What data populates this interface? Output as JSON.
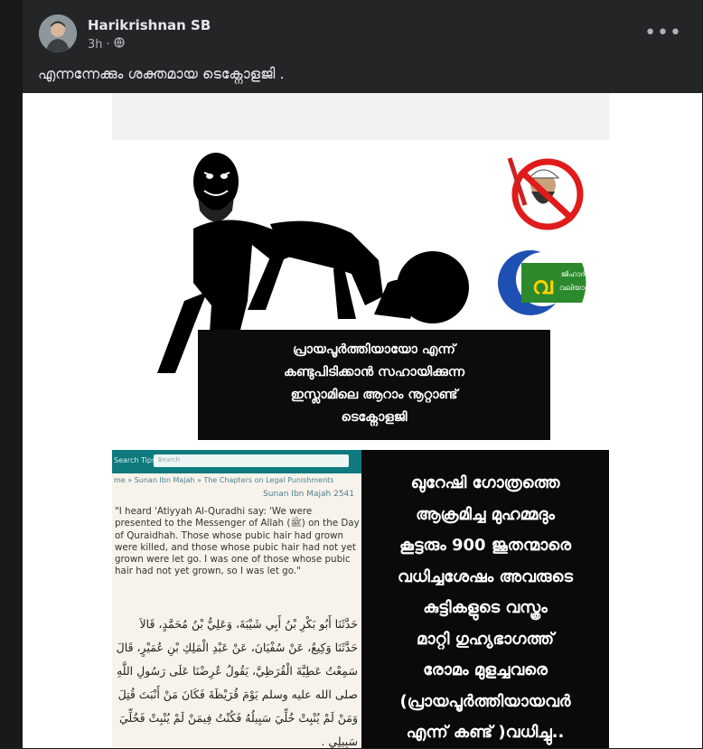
{
  "post": {
    "author": "Harikrishnan SB",
    "time": "3h",
    "separator": "·",
    "privacy_icon": "globe-icon",
    "more_icon": "more-horizontal-icon",
    "text": "എന്നന്നേക്കും ശക്തമായ ടെക്നോളജി ."
  },
  "image": {
    "stamp_lines": [
      "പ്രായപൂർത്തിയായോ എന്ന്",
      "കണ്ടുപിടിക്കാൻ സഹായിക്കുന്ന",
      "ഇസ്ലാമിലെ ആറാം നൂറ്റാണ്ട്",
      "ടെക്നോളജി"
    ],
    "logo_text": "ജിഹാദി വലിയാൾ",
    "site": {
      "search_tips": "Search Tips",
      "search_placeholder": "Search",
      "breadcrumb": "me » Sunan Ibn Majah » The Chapters on Legal Punishments",
      "reference": "Sunan Ibn Majah 2541",
      "quote": "\"I heard 'Atiyyah Al-Quradhi say: 'We were presented to the Messenger of Allah (ﷺ) on the Day of Quraidhah. Those whose pubic hair had grown were killed, and those whose pubic hair had not yet grown were let go. I was one of those whose pubic hair had not yet grown, so I was let go.\"",
      "arabic": "حَدَّثَنَا أَبُو بَكْرِ بْنُ أَبِي شَيْبَةَ، وَعَلِيُّ بْنُ مُحَمَّدٍ، قَالاَ حَدَّثَنَا وَكِيعٌ، عَنْ سُفْيَانَ، عَنْ عَبْدِ الْمَلِكِ بْنِ عُمَيْرٍ، قَالَ سَمِعْتُ عَطِيَّةَ الْقُرَظِيَّ، يَقُولُ عُرِضْنَا عَلَى رَسُولِ اللَّهِ صلى الله عليه وسلم يَوْمَ قُرَيْظَةَ فَكَانَ مَنْ أَنْبَتَ قُتِلَ وَمَنْ لَمْ يُنْبِتْ خُلِّيَ سَبِيلُهُ فَكُنْتُ فِيمَنْ لَمْ يُنْبِتْ فَخُلِّيَ سَبِيلِي ."
    },
    "right_lines": [
      "ഖുറേഷി ഗോത്രത്തെ",
      "ആക്രമിച്ച മുഹമ്മദും",
      "കൂട്ടരും 900 ജൂതന്മാരെ",
      "വധിച്ചശേഷം അവരുടെ",
      "കുട്ടികളുടെ വസ്ത്രം",
      "മാറ്റി ഗുഹ്യഭാഗത്ത്",
      "രോമം മുളച്ചവരെ",
      "(പ്രായപൂർത്തിയായവർ",
      "എന്ന് കണ്ട് )വധിച്ചു.."
    ]
  }
}
